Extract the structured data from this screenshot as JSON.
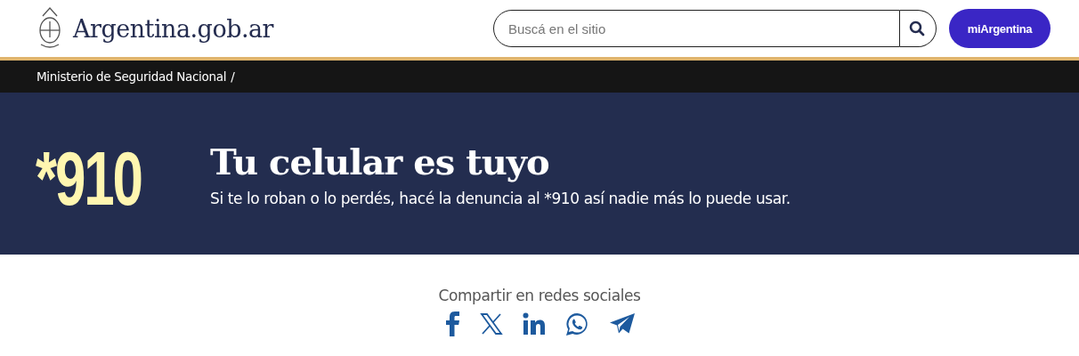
{
  "header": {
    "logo_text": "Argentina.gob.ar",
    "search": {
      "placeholder": "Buscá en el sitio"
    },
    "account_button": "miArgentina"
  },
  "breadcrumb": [
    "Ministerio de Seguridad Nacional",
    "/"
  ],
  "banner": {
    "number": "*910",
    "title": "Tu celular es tuyo",
    "subtitle": "Si te lo roban o lo perdés, hacé la denuncia al *910 así nadie más lo puede usar."
  },
  "share": {
    "label": "Compartir en redes sociales",
    "icons": [
      {
        "kind": "facebook"
      },
      {
        "kind": "x"
      },
      {
        "kind": "linkedin"
      },
      {
        "kind": "whatsapp"
      },
      {
        "kind": "telegram"
      }
    ]
  }
}
